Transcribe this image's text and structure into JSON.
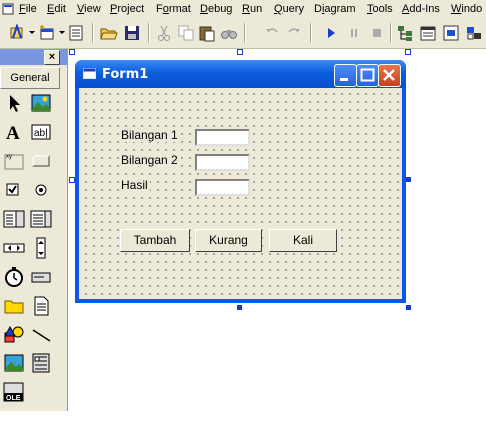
{
  "menu": [
    {
      "label": "File",
      "underline": "F",
      "rest": "ile"
    },
    {
      "label": "Edit",
      "underline": "E",
      "rest": "dit"
    },
    {
      "label": "View",
      "underline": "V",
      "rest": "iew"
    },
    {
      "label": "Project",
      "underline": "P",
      "rest": "roject"
    },
    {
      "label": "Format",
      "underline": "o",
      "rest": ""
    },
    {
      "label": "Debug",
      "underline": "D",
      "rest": "ebug"
    },
    {
      "label": "Run",
      "underline": "R",
      "rest": "un"
    },
    {
      "label": "Query",
      "underline": "Q",
      "rest": "uery"
    },
    {
      "label": "Diagram",
      "underline": "i",
      "rest": ""
    },
    {
      "label": "Tools",
      "underline": "T",
      "rest": "ools"
    },
    {
      "label": "Add-Ins",
      "underline": "A",
      "rest": "dd-Ins"
    },
    {
      "label": "Windo",
      "underline": "W",
      "rest": "indo"
    }
  ],
  "toolbox": {
    "close_glyph": "×",
    "tab_label": "General",
    "tools": [
      "pointer-icon",
      "picturebox-icon",
      "label-icon",
      "textbox-icon",
      "frame-icon",
      "commandbutton-icon",
      "checkbox-icon",
      "optionbutton-icon",
      "combobox-icon",
      "listbox-icon",
      "hscrollbar-icon",
      "vscrollbar-icon",
      "timer-icon",
      "drivelistbox-icon",
      "dirlistbox-icon",
      "filelistbox-icon",
      "shape-icon",
      "line-icon",
      "image-icon",
      "data-icon",
      "ole-icon"
    ],
    "label_glyph": "A",
    "textbox_glyph": "ab|",
    "ole_glyph": "OLE"
  },
  "form": {
    "title": "Form1",
    "labels": [
      "Bilangan 1",
      "Bilangan 2",
      "Hasil"
    ],
    "buttons": [
      "Tambah",
      "Kurang",
      "Kali"
    ]
  },
  "colors": {
    "titlebar_blue": "#0a57e8",
    "close_red": "#c8401b",
    "chrome": "#ece9d8"
  }
}
